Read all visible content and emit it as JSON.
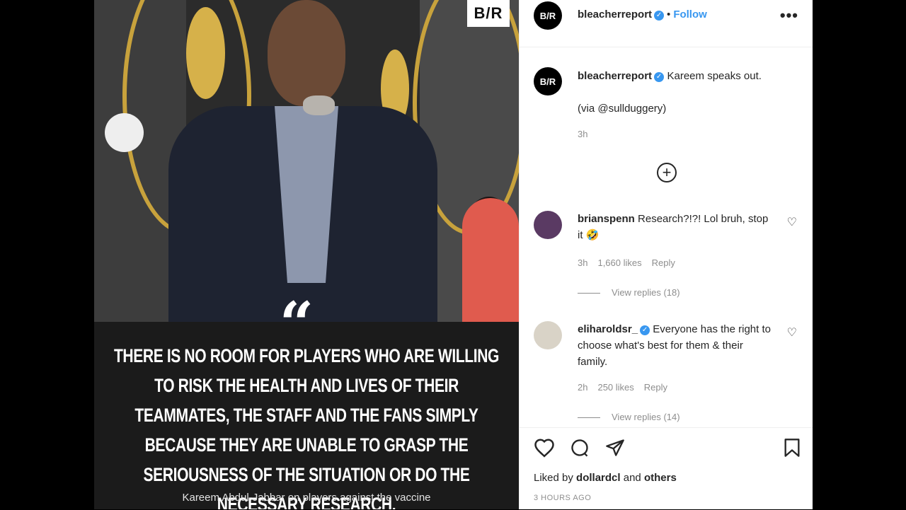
{
  "image": {
    "logo": "B/R",
    "quote_mark": "“",
    "quote": "THERE IS NO ROOM FOR PLAYERS WHO ARE WILLING TO RISK THE HEALTH AND LIVES OF THEIR TEAMMATES, THE STAFF AND THE FANS SIMPLY BECAUSE THEY ARE UNABLE TO GRASP THE SERIOUSNESS OF THE SITUATION OR DO THE NECESSARY RESEARCH.",
    "attribution": "Kareem Abdul-Jabbar on players against the vaccine"
  },
  "header": {
    "avatar_text": "B/R",
    "username": "bleacherreport",
    "separator": "•",
    "follow_label": "Follow",
    "more_icon": "more-options-icon",
    "more_glyph": "•••"
  },
  "caption": {
    "username": "bleacherreport",
    "text": "Kareem speaks out.",
    "via": "(via @sullduggery)",
    "time": "3h"
  },
  "load_more_glyph": "+",
  "comments": [
    {
      "username": "brianspenn",
      "text": "Research?!?! Lol bruh, stop it 🤣",
      "time": "3h",
      "likes": "1,660 likes",
      "reply_label": "Reply",
      "view_replies": "View replies (18)",
      "avatar_color": "#5a3a63"
    },
    {
      "username": "eliharoldsr_",
      "verified": true,
      "text": "Everyone has the right to choose what's best for them & their family.",
      "time": "2h",
      "likes": "250 likes",
      "reply_label": "Reply",
      "view_replies": "View replies (14)",
      "avatar_color": "#d9d3c7"
    }
  ],
  "actions": {
    "like_icon": "heart-icon",
    "comment_icon": "comment-icon",
    "share_icon": "share-icon",
    "save_icon": "bookmark-icon",
    "liked_by_prefix": "Liked by",
    "liked_by_user": "dollardcl",
    "liked_by_and": "and",
    "liked_by_others": "others",
    "time": "3 HOURS AGO"
  },
  "colors": {
    "accent": "#3897f0",
    "quote_bg": "#1b1b1b",
    "photo_gold": "#c8a23c"
  }
}
